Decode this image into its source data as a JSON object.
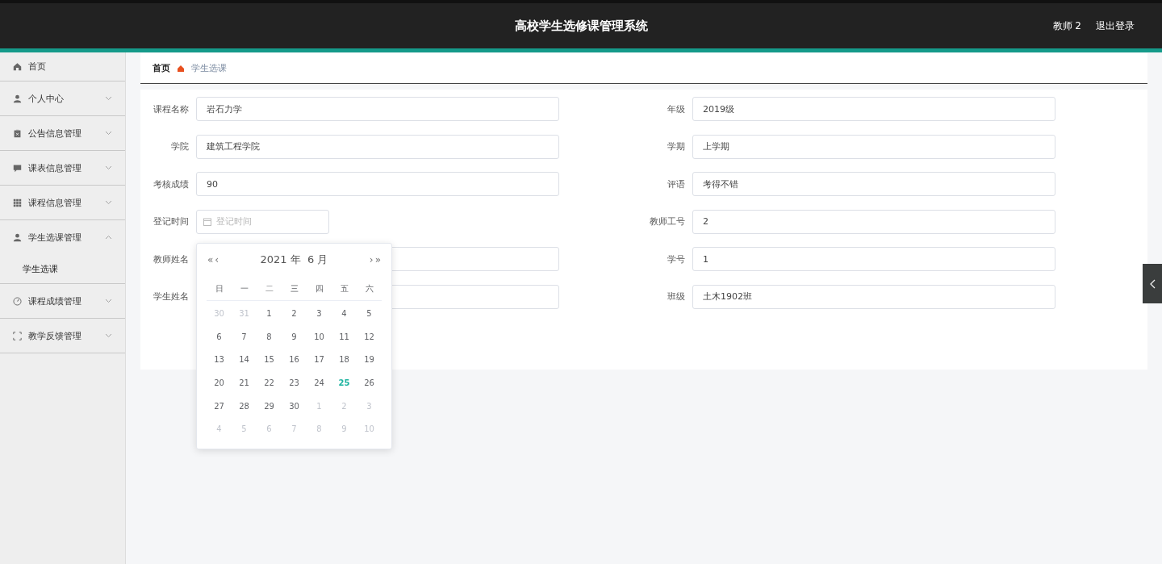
{
  "header": {
    "title": "高校学生选修课管理系统",
    "user": "教师 2",
    "logout": "退出登录"
  },
  "sidebar": {
    "items": [
      {
        "label": "首页",
        "kind": "link"
      },
      {
        "label": "个人中心",
        "kind": "submenu",
        "expanded": false
      },
      {
        "label": "公告信息管理",
        "kind": "submenu",
        "expanded": false
      },
      {
        "label": "课表信息管理",
        "kind": "submenu",
        "expanded": false
      },
      {
        "label": "课程信息管理",
        "kind": "submenu",
        "expanded": false
      },
      {
        "label": "学生选课管理",
        "kind": "submenu",
        "expanded": true,
        "children": [
          {
            "label": "学生选课"
          }
        ]
      },
      {
        "label": "课程成绩管理",
        "kind": "submenu",
        "expanded": false
      },
      {
        "label": "教学反馈管理",
        "kind": "submenu",
        "expanded": false
      }
    ]
  },
  "breadcrumb": [
    "首页",
    "学生选课"
  ],
  "form": {
    "fields": [
      {
        "label": "课程名称",
        "kind": "text",
        "value": "岩石力学"
      },
      {
        "label": "年级",
        "kind": "text",
        "value": "2019级"
      },
      {
        "label": "学院",
        "kind": "text",
        "value": "建筑工程学院"
      },
      {
        "label": "学期",
        "kind": "text",
        "value": "上学期"
      },
      {
        "label": "考核成绩",
        "kind": "text",
        "value": "90"
      },
      {
        "label": "评语",
        "kind": "text",
        "value": "考得不错"
      },
      {
        "label": "登记时间",
        "kind": "date",
        "placeholder": "登记时间"
      },
      {
        "label": "教师工号",
        "kind": "text",
        "value": "2"
      },
      {
        "label": "教师姓名",
        "kind": "text"
      },
      {
        "label": "学号",
        "kind": "text",
        "value": "1"
      },
      {
        "label": "学生姓名",
        "kind": "text"
      },
      {
        "label": "班级",
        "kind": "text",
        "value": "土木1902班"
      }
    ]
  },
  "datepicker": {
    "prev_year": "«",
    "prev_month": "‹",
    "title": "2021 年  6 月",
    "next_month": "›",
    "next_year": "»",
    "weekdays": [
      "日",
      "一",
      "二",
      "三",
      "四",
      "五",
      "六"
    ],
    "weeks": [
      [
        {
          "day": "30",
          "muted": true,
          "today": false
        },
        {
          "day": "31",
          "muted": true,
          "today": false
        },
        {
          "day": "1",
          "muted": false,
          "today": false
        },
        {
          "day": "2",
          "muted": false,
          "today": false
        },
        {
          "day": "3",
          "muted": false,
          "today": false
        },
        {
          "day": "4",
          "muted": false,
          "today": false
        },
        {
          "day": "5",
          "muted": false,
          "today": false
        }
      ],
      [
        {
          "day": "6",
          "muted": false,
          "today": false
        },
        {
          "day": "7",
          "muted": false,
          "today": false
        },
        {
          "day": "8",
          "muted": false,
          "today": false
        },
        {
          "day": "9",
          "muted": false,
          "today": false
        },
        {
          "day": "10",
          "muted": false,
          "today": false
        },
        {
          "day": "11",
          "muted": false,
          "today": false
        },
        {
          "day": "12",
          "muted": false,
          "today": false
        }
      ],
      [
        {
          "day": "13",
          "muted": false,
          "today": false
        },
        {
          "day": "14",
          "muted": false,
          "today": false
        },
        {
          "day": "15",
          "muted": false,
          "today": false
        },
        {
          "day": "16",
          "muted": false,
          "today": false
        },
        {
          "day": "17",
          "muted": false,
          "today": false
        },
        {
          "day": "18",
          "muted": false,
          "today": false
        },
        {
          "day": "19",
          "muted": false,
          "today": false
        }
      ],
      [
        {
          "day": "20",
          "muted": false,
          "today": false
        },
        {
          "day": "21",
          "muted": false,
          "today": false
        },
        {
          "day": "22",
          "muted": false,
          "today": false
        },
        {
          "day": "23",
          "muted": false,
          "today": false
        },
        {
          "day": "24",
          "muted": false,
          "today": false
        },
        {
          "day": "25",
          "muted": false,
          "today": true
        },
        {
          "day": "26",
          "muted": false,
          "today": false
        }
      ],
      [
        {
          "day": "27",
          "muted": false,
          "today": false
        },
        {
          "day": "28",
          "muted": false,
          "today": false
        },
        {
          "day": "29",
          "muted": false,
          "today": false
        },
        {
          "day": "30",
          "muted": false,
          "today": false
        },
        {
          "day": "1",
          "muted": true,
          "today": false
        },
        {
          "day": "2",
          "muted": true,
          "today": false
        },
        {
          "day": "3",
          "muted": true,
          "today": false
        }
      ],
      [
        {
          "day": "4",
          "muted": true,
          "today": false
        },
        {
          "day": "5",
          "muted": true,
          "today": false
        },
        {
          "day": "6",
          "muted": true,
          "today": false
        },
        {
          "day": "7",
          "muted": true,
          "today": false
        },
        {
          "day": "8",
          "muted": true,
          "today": false
        },
        {
          "day": "9",
          "muted": true,
          "today": false
        },
        {
          "day": "10",
          "muted": true,
          "today": false
        }
      ]
    ]
  }
}
